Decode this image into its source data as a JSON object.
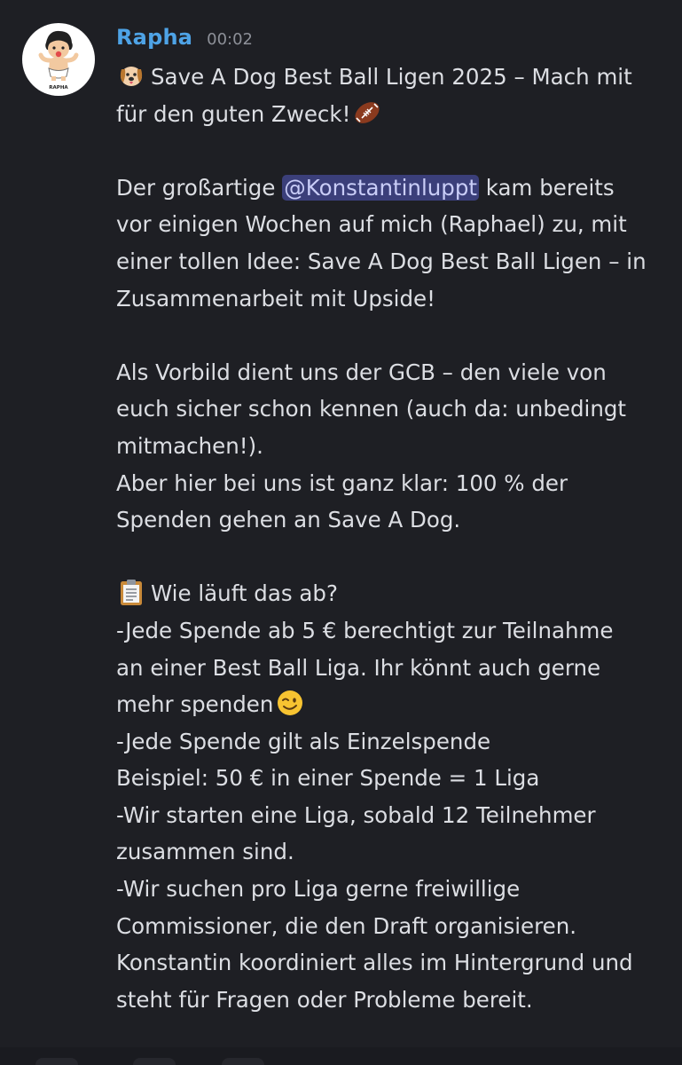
{
  "message": {
    "username": "Rapha",
    "timestamp": "00:02",
    "avatar": {
      "caption": "RAPHA",
      "icon": "cartoon-avatar"
    },
    "title_line1": "Save A Dog Best Ball Ligen 2025 – Mach mit",
    "title_line2": "für den guten Zweck!",
    "p1": {
      "l1_pre": "Der großartige ",
      "mention": "@Konstantinluppt",
      "l1_post": " kam bereits",
      "l2": "vor einigen Wochen auf mich (Raphael) zu, mit",
      "l3": "einer tollen Idee: Save A Dog Best Ball Ligen – in",
      "l4": "Zusammenarbeit mit Upside!"
    },
    "p2": {
      "l1": "Als Vorbild dient uns der GCB – den viele von",
      "l2": "euch sicher schon kennen (auch da: unbedingt",
      "l3": "mitmachen!).",
      "l4": "Aber hier bei uns ist ganz klar: 100 % der",
      "l5": "Spenden gehen an Save A Dog."
    },
    "p3": {
      "heading": "Wie läuft das ab?",
      "l1": "-Jede Spende ab 5 € berechtigt zur Teilnahme",
      "l2": "an einer Best Ball Liga. Ihr könnt auch gerne",
      "l3": "mehr spenden",
      "l4": "-Jede Spende gilt als Einzelspende",
      "l5": "Beispiel: 50 € in einer Spende = 1 Liga",
      "l6": "-Wir starten eine Liga, sobald 12 Teilnehmer",
      "l7": "zusammen sind.",
      "l8": "-Wir suchen pro Liga gerne freiwillige",
      "l9": "Commissioner, die den Draft organisieren.",
      "l10": "Konstantin koordiniert alles im Hintergrund und",
      "l11": "steht für Fragen oder Probleme bereit."
    },
    "emojis": {
      "title_start": "dog-face-icon",
      "title_end": "american-football-icon",
      "heading": "clipboard-icon",
      "wink": "winking-face-icon"
    }
  },
  "colors": {
    "background": "#1e1f24",
    "username": "#4ea3e6",
    "timestamp": "#8d9098",
    "text": "#dcdee3",
    "mention_bg": "#3b3f7a",
    "mention_text": "#c9cdf7"
  }
}
